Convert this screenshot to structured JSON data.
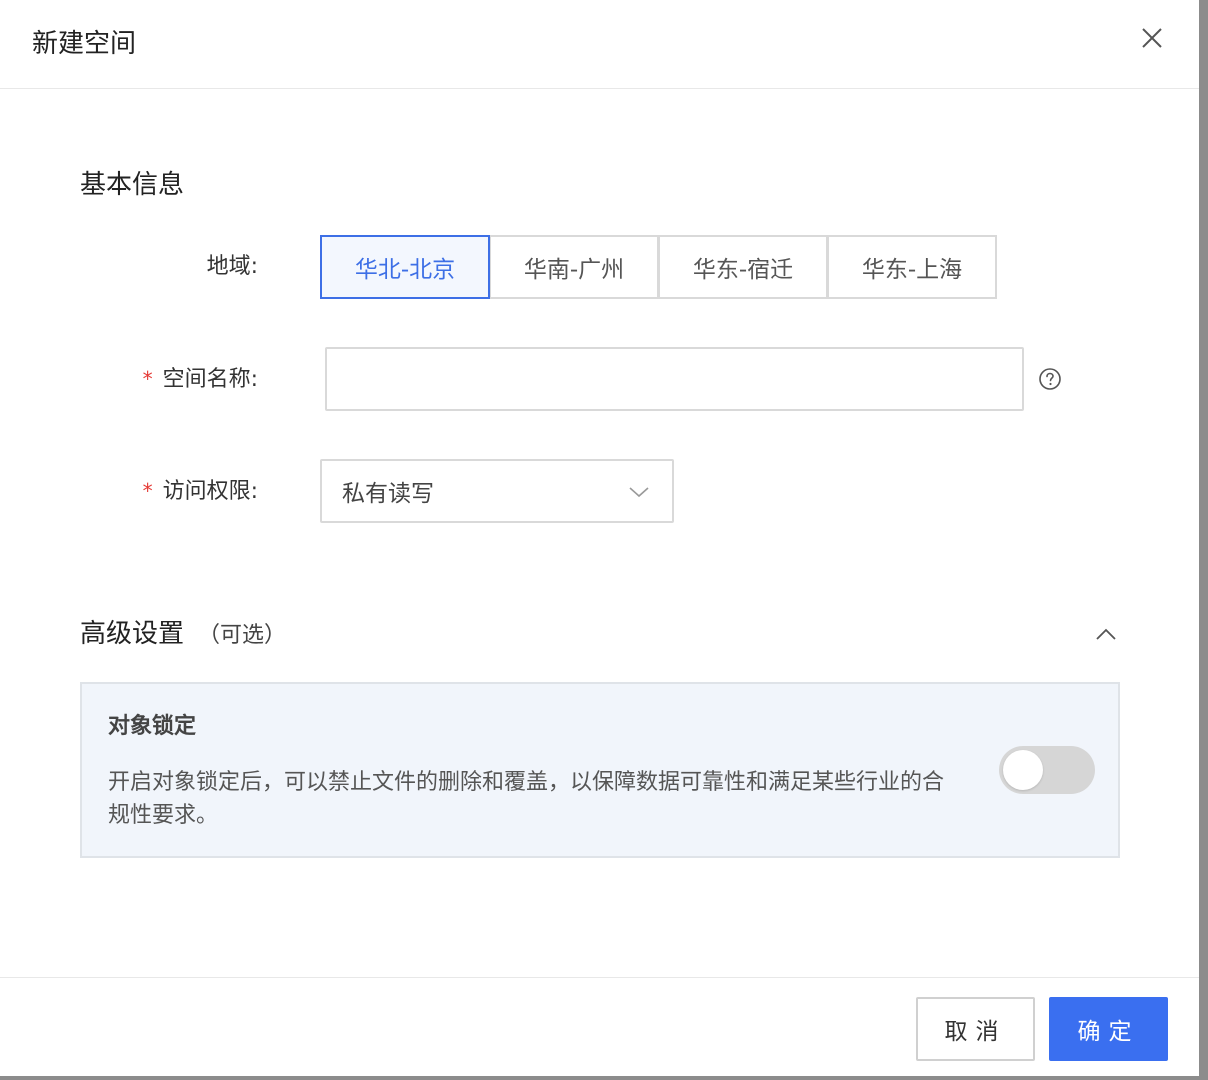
{
  "dialog": {
    "title": "新建空间"
  },
  "basic": {
    "title": "基本信息",
    "region": {
      "label": "地域:",
      "options": [
        "华北-北京",
        "华南-广州",
        "华东-宿迁",
        "华东-上海"
      ],
      "selected": "华北-北京"
    },
    "name": {
      "required_mark": "*",
      "label": "空间名称:",
      "value": "",
      "placeholder": ""
    },
    "access": {
      "required_mark": "*",
      "label": "访问权限:",
      "value": "私有读写"
    }
  },
  "advanced": {
    "title": "高级设置",
    "optional": "（可选）",
    "object_lock": {
      "title": "对象锁定",
      "description": "开启对象锁定后，可以禁止文件的删除和覆盖，以保障数据可靠性和满足某些行业的合规性要求。",
      "enabled": false
    }
  },
  "footer": {
    "cancel_label": "取消",
    "ok_label": "确定"
  },
  "colors": {
    "accent": "#3a6ff0",
    "required": "#e53935",
    "card_bg": "#f1f5fb"
  }
}
